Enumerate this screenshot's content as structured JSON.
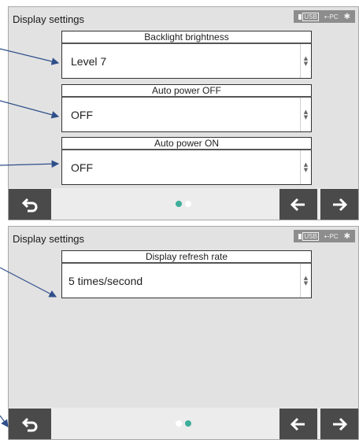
{
  "screens": [
    {
      "title": "Display settings",
      "status": {
        "usb": "USB",
        "pc": "PC",
        "bluetooth": "✱"
      },
      "settings": [
        {
          "label": "Backlight brightness",
          "value": "Level 7"
        },
        {
          "label": "Auto power OFF",
          "value": "OFF"
        },
        {
          "label": "Auto power ON",
          "value": "OFF"
        }
      ],
      "page_indicator": {
        "pages": 2,
        "current": 1
      }
    },
    {
      "title": "Display settings",
      "status": {
        "usb": "USB",
        "pc": "PC",
        "bluetooth": "✱"
      },
      "settings": [
        {
          "label": "Display refresh rate",
          "value": "5 times/second"
        }
      ],
      "page_indicator": {
        "pages": 2,
        "current": 2
      }
    }
  ],
  "icons": {
    "back": "return-arrow-icon",
    "prev": "arrow-left-icon",
    "next": "arrow-right-icon",
    "spinner": "up-down-spinner-icon"
  },
  "colors": {
    "button_bg": "#4a4a4a",
    "active_dot": "#3dae9a",
    "callout_arrow": "#2f4f8a"
  }
}
